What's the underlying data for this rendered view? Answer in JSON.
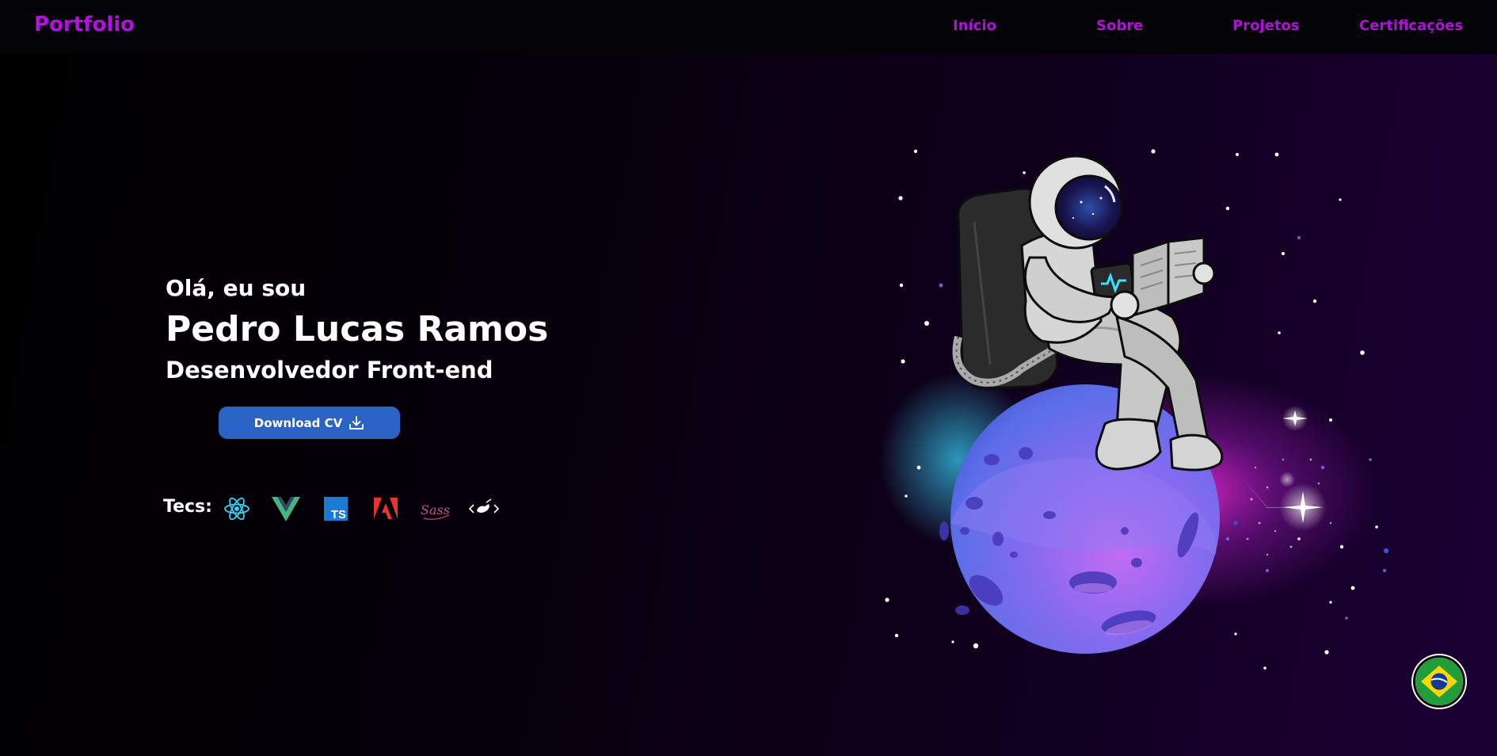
{
  "header": {
    "brand": "Portfolio",
    "nav": [
      "Início",
      "Sobre",
      "Projetos",
      "Certificações"
    ]
  },
  "hero": {
    "greeting": "Olá, eu sou",
    "name": "Pedro Lucas Ramos",
    "role": "Desenvolvedor Front-end",
    "cv_button": "Download CV",
    "tecs_label": "Tecs:",
    "tecs": [
      "react-icon",
      "vue-icon",
      "typescript-icon",
      "adobe-icon",
      "sass-icon",
      "styled-components-icon"
    ],
    "ts_badge": "TS",
    "sass_text": "Sass"
  },
  "illustration": "astronaut-reading-on-planet",
  "language_button": "brazil-flag-icon",
  "colors": {
    "accent": "#b011d8",
    "button": "#2b63c4",
    "background": "#000000"
  }
}
